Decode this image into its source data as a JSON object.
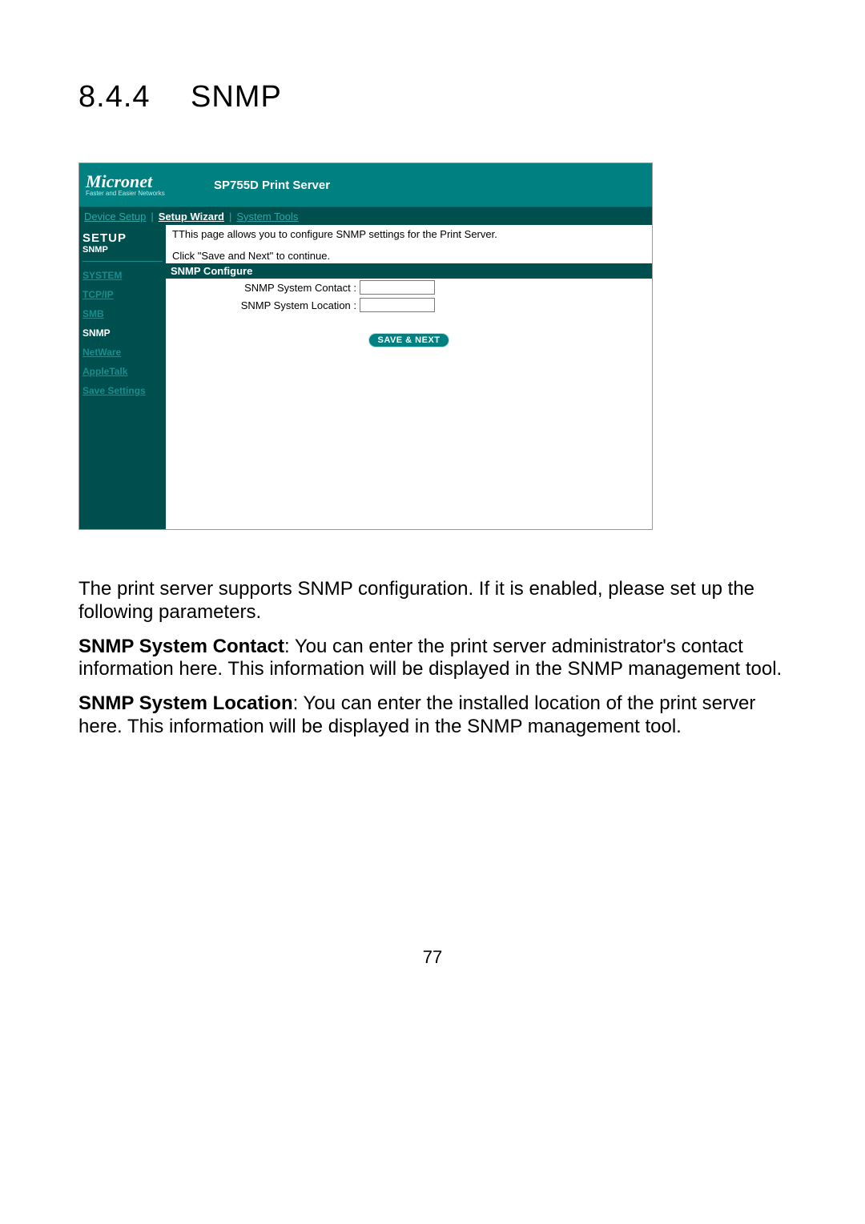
{
  "heading": {
    "number": "8.4.4",
    "title": "SNMP"
  },
  "screenshot": {
    "brand": {
      "name": "Micronet",
      "tagline": "Faster and Easier Networks"
    },
    "header_title": "SP755D Print Server",
    "top_nav": {
      "device_setup": "Device Setup",
      "setup_wizard": "Setup Wizard",
      "system_tools": "System Tools",
      "sep": "|"
    },
    "sidebar": {
      "setup": "SETUP",
      "subtitle": "SNMP",
      "items": [
        {
          "label": "SYSTEM",
          "active": false
        },
        {
          "label": "TCP/IP",
          "active": false
        },
        {
          "label": "SMB",
          "active": false
        },
        {
          "label": "SNMP",
          "active": true
        },
        {
          "label": "NetWare",
          "active": false
        },
        {
          "label": "AppleTalk",
          "active": false
        },
        {
          "label": "Save Settings",
          "active": false
        }
      ]
    },
    "content": {
      "intro1": "TThis page allows you to configure SNMP settings for the Print Server.",
      "intro2": "Click \"Save and Next\" to continue.",
      "section_title": "SNMP Configure",
      "fields": {
        "contact_label": "SNMP System Contact :",
        "contact_value": "",
        "location_label": "SNMP System Location :",
        "location_value": ""
      },
      "button": "SAVE & NEXT"
    }
  },
  "body": {
    "p1": "The print server supports SNMP configuration. If it is enabled, please set up the following parameters.",
    "p2_bold": "SNMP System Contact",
    "p2_rest": ": You can enter the print server administrator's contact information here. This information will be displayed in the SNMP management tool.",
    "p3_bold": "SNMP System Location",
    "p3_rest": ": You can enter the installed location of the print server here. This information will be displayed in the SNMP management tool."
  },
  "page_number": "77"
}
